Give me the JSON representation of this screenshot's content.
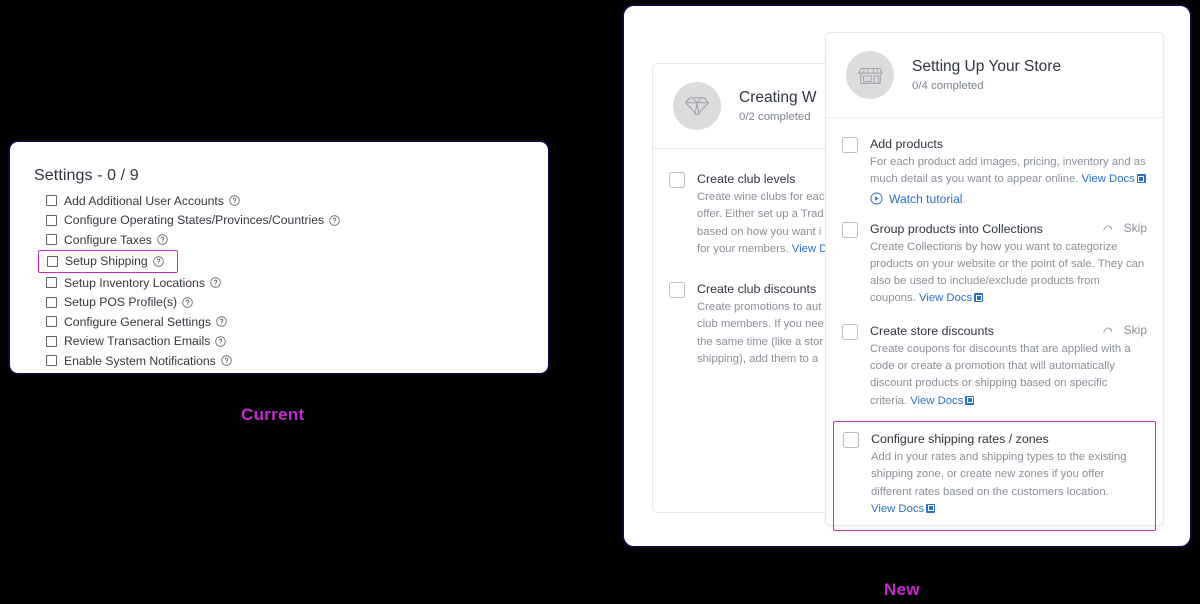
{
  "captions": {
    "current": "Current",
    "new": "New"
  },
  "current_panel": {
    "title": "Settings - 0 / 9",
    "items": [
      {
        "label": "Add Additional User Accounts",
        "help_icon": "question-circle-icon",
        "highlighted": false
      },
      {
        "label": "Configure Operating States/Provinces/Countries",
        "help_icon": "question-circle-icon",
        "highlighted": false
      },
      {
        "label": "Configure Taxes",
        "help_icon": "question-circle-icon",
        "highlighted": false
      },
      {
        "label": "Setup Shipping",
        "help_icon": "question-circle-icon",
        "highlighted": true
      },
      {
        "label": "Setup Inventory Locations",
        "help_icon": "question-circle-icon",
        "highlighted": false
      },
      {
        "label": "Setup POS Profile(s)",
        "help_icon": "question-circle-icon",
        "highlighted": false
      },
      {
        "label": "Configure General Settings",
        "help_icon": "question-circle-icon",
        "highlighted": false
      },
      {
        "label": "Review Transaction Emails",
        "help_icon": "question-circle-icon",
        "highlighted": false
      },
      {
        "label": "Enable System Notifications",
        "help_icon": "question-circle-icon",
        "highlighted": false
      }
    ],
    "highlight_color": "#c02fc0"
  },
  "new_panel": {
    "back_card": {
      "icon": "diamond-icon",
      "title": "Creating W",
      "subtitle": "0/2 completed",
      "tasks": [
        {
          "title": "Create club levels",
          "desc_lines": [
            "Create wine clubs for eac",
            "offer. Either set up a Trad",
            "based on how you want i",
            "for your members. "
          ],
          "link_text": "View D"
        },
        {
          "title": "Create club discounts",
          "desc_lines": [
            "Create promotions to aut",
            "club members. If you nee",
            "the same time (like a stor",
            "shipping), add them to a "
          ],
          "link_text": ""
        }
      ]
    },
    "front_card": {
      "icon": "storefront-icon",
      "title": "Setting Up Your Store",
      "subtitle": "0/4 completed",
      "tasks": [
        {
          "title": "Add products",
          "desc": "For each product add images, pricing, inventory and as much detail as you want to appear online. ",
          "link_text": "View Docs",
          "link_icon": "external-link-icon",
          "watch_label": "Watch tutorial",
          "watch_icon": "play-circle-icon",
          "skip_label": null,
          "highlighted": false
        },
        {
          "title": "Group products into Collections",
          "desc": "Create Collections by how you want to categorize products on your website or the point of sale. They can also be used to include/exclude products from coupons. ",
          "link_text": "View Docs",
          "link_icon": "external-link-icon",
          "watch_label": null,
          "skip_label": "Skip",
          "skip_icon": "skip-arrow-icon",
          "highlighted": false
        },
        {
          "title": "Create store discounts",
          "desc": "Create coupons for discounts that are applied with a code or create a promotion that will automatically discount products or shipping based on specific criteria. ",
          "link_text": "View Docs",
          "link_icon": "external-link-icon",
          "watch_label": null,
          "skip_label": "Skip",
          "skip_icon": "skip-arrow-icon",
          "highlighted": false
        },
        {
          "title": "Configure shipping rates / zones",
          "desc": "Add in your rates and shipping types to the existing shipping zone, or create new zones if you offer different rates based on the customers location. ",
          "link_text": "View Docs",
          "link_icon": "external-link-icon",
          "watch_label": null,
          "skip_label": null,
          "highlighted": true
        }
      ],
      "highlight_color": "#b836b8"
    }
  },
  "colors": {
    "page_background": "#000000",
    "panel_border": "#0b0b3b",
    "caption": "#c42ad0",
    "link": "#2a72c4",
    "muted_text": "#8a8f99"
  }
}
